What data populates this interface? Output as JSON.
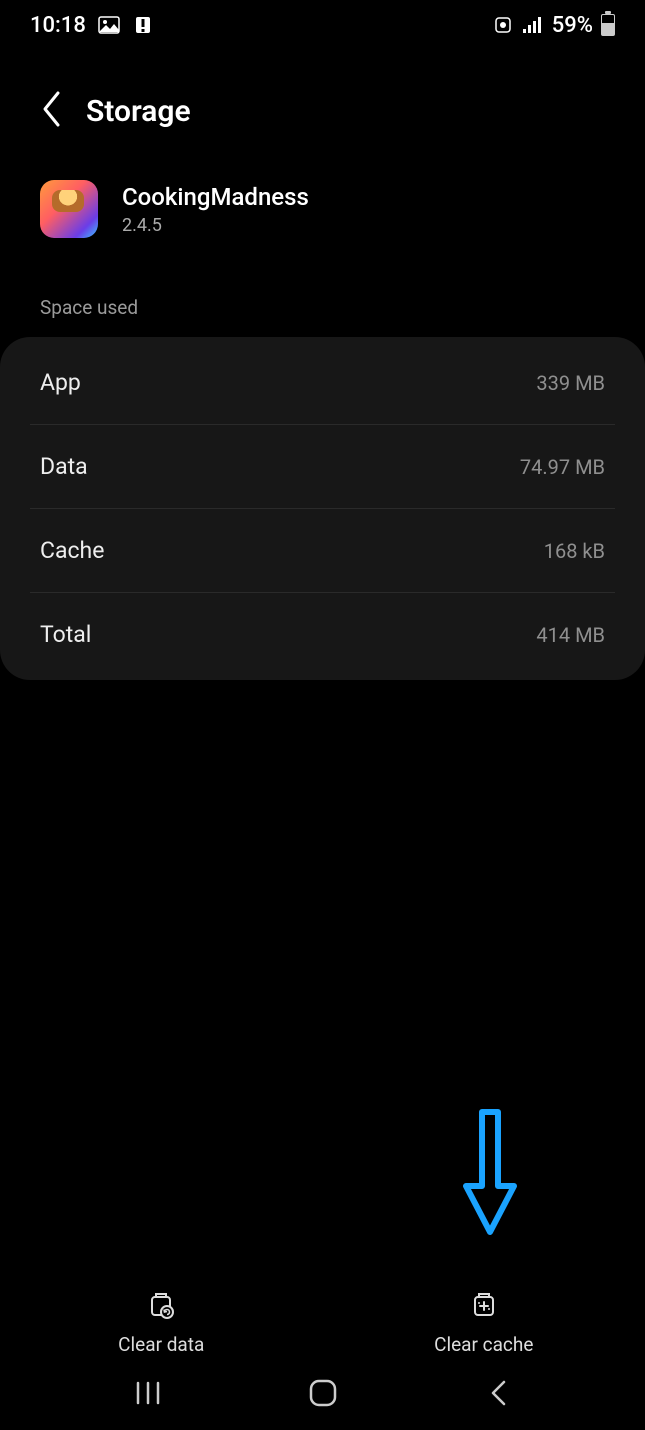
{
  "status_bar": {
    "time": "10:18",
    "battery_text": "59%"
  },
  "header": {
    "title": "Storage"
  },
  "app": {
    "name": "CookingMadness",
    "version": "2.4.5"
  },
  "section_label": "Space used",
  "rows": {
    "app_label": "App",
    "app_value": "339 MB",
    "data_label": "Data",
    "data_value": "74.97 MB",
    "cache_label": "Cache",
    "cache_value": "168 kB",
    "total_label": "Total",
    "total_value": "414 MB"
  },
  "actions": {
    "clear_data": "Clear data",
    "clear_cache": "Clear cache"
  }
}
